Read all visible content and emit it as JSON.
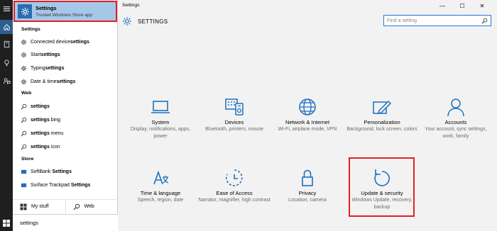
{
  "start": {
    "best_match": {
      "title": "Settings",
      "subtitle": "Trusted Windows Store app"
    },
    "groups": {
      "settings": {
        "header": "Settings",
        "items": [
          {
            "pre": "Connected device ",
            "bold": "settings",
            "icon": "gear-icon"
          },
          {
            "pre": "Start ",
            "bold": "settings",
            "icon": "gear-icon"
          },
          {
            "pre": "Typing ",
            "bold": "settings",
            "icon": "gear-icon"
          },
          {
            "pre": "Date & time ",
            "bold": "settings",
            "icon": "gear-icon"
          }
        ]
      },
      "web": {
        "header": "Web",
        "items": [
          {
            "pre": "",
            "bold": "settings",
            "post": "",
            "icon": "search-icon"
          },
          {
            "pre": "",
            "bold": "settings",
            "post": " bing",
            "icon": "search-icon"
          },
          {
            "pre": "",
            "bold": "settings",
            "post": " menu",
            "icon": "search-icon"
          },
          {
            "pre": "",
            "bold": "settings",
            "post": " icon",
            "icon": "search-icon"
          }
        ]
      },
      "store": {
        "header": "Store",
        "items": [
          {
            "pre": "SoftBank ",
            "bold": "Settings",
            "icon": "store-app-icon"
          },
          {
            "pre": "Surface Trackpad ",
            "bold": "Settings",
            "icon": "store-app-icon"
          }
        ]
      }
    },
    "bottom": {
      "my_stuff": "My stuff",
      "web": "Web"
    },
    "search_value": "settings"
  },
  "window": {
    "title": "Settings",
    "header": "SETTINGS",
    "search_placeholder": "Find a setting",
    "controls": {
      "minimize": "—",
      "maximize": "☐",
      "close": "✕"
    },
    "tiles": [
      {
        "name": "System",
        "desc": "Display, notifications, apps, power",
        "icon": "laptop-icon"
      },
      {
        "name": "Devices",
        "desc": "Bluetooth, printers, mouse",
        "icon": "devices-icon"
      },
      {
        "name": "Network & Internet",
        "desc": "Wi-Fi, airplane mode, VPN",
        "icon": "globe-icon"
      },
      {
        "name": "Personalization",
        "desc": "Background, lock screen, colors",
        "icon": "paint-icon"
      },
      {
        "name": "Accounts",
        "desc": "Your account, sync settings, work, family",
        "icon": "person-icon"
      },
      {
        "name": "Time & language",
        "desc": "Speech, region, date",
        "icon": "time-language-icon"
      },
      {
        "name": "Ease of Access",
        "desc": "Narrator, magnifier, high contrast",
        "icon": "ease-of-access-icon"
      },
      {
        "name": "Privacy",
        "desc": "Location, camera",
        "icon": "lock-icon"
      },
      {
        "name": "Update & security",
        "desc": "Windows Update, recovery, backup",
        "icon": "update-icon"
      }
    ]
  },
  "colors": {
    "accent": "#1e6fc0",
    "highlight": "#a6c8e8",
    "annotation": "#e41e26"
  }
}
